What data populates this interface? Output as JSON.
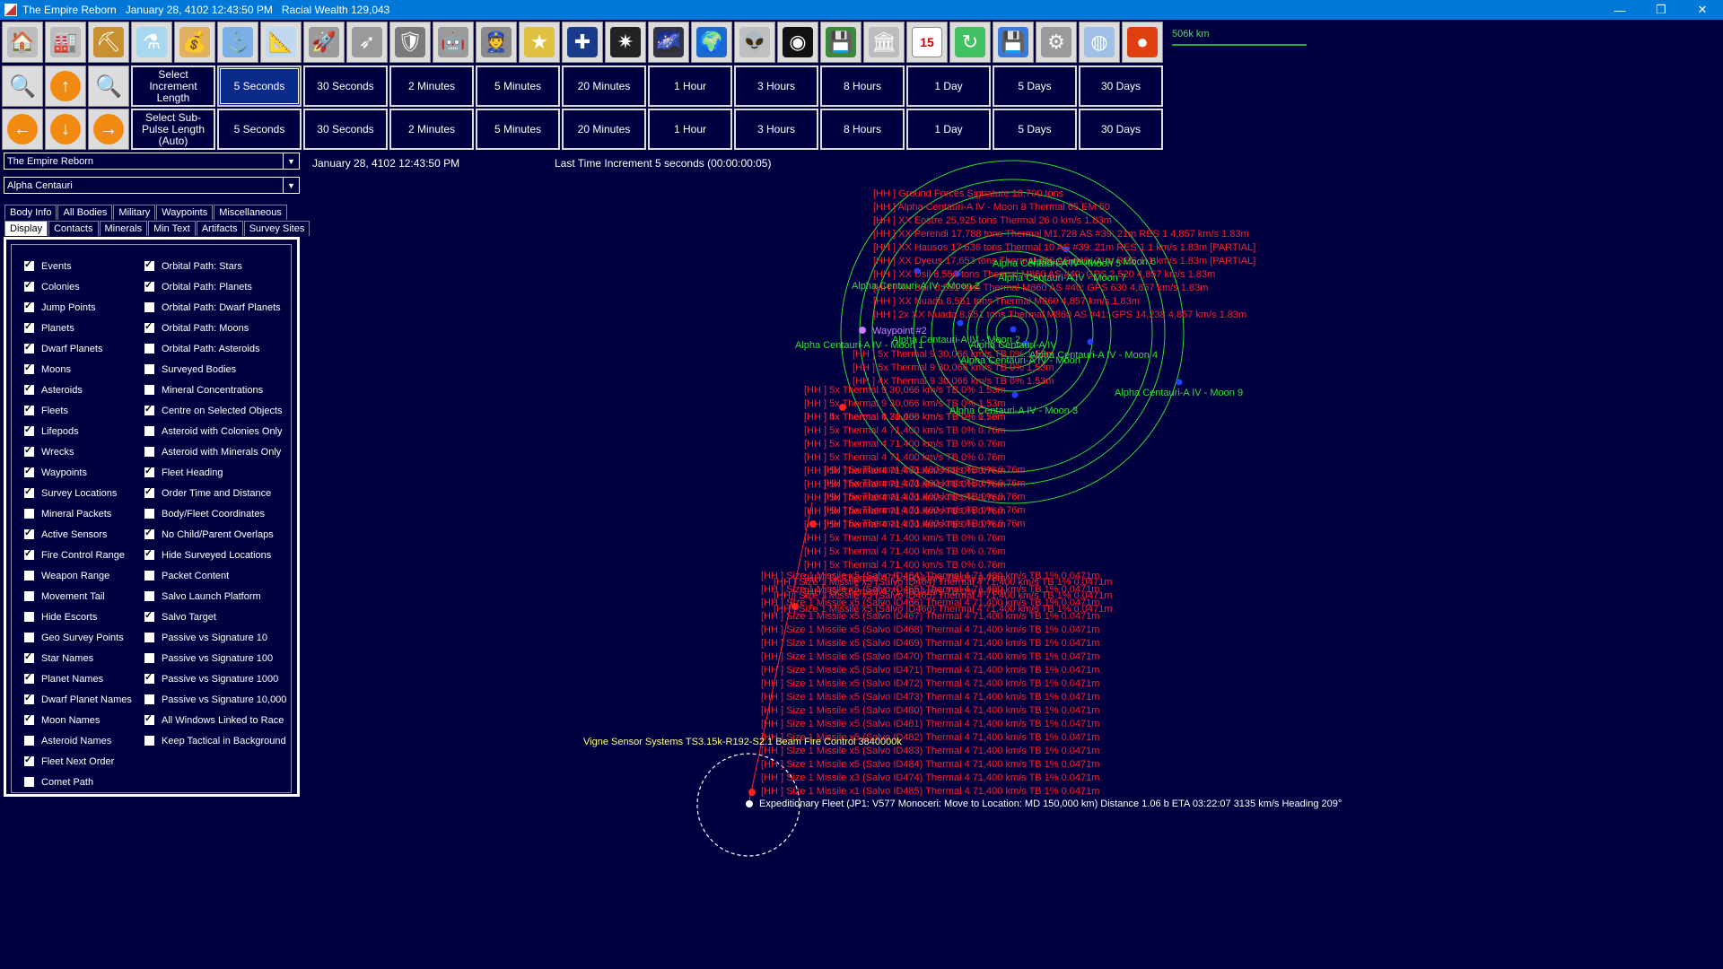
{
  "window": {
    "title": "The Empire Reborn   January 28, 4102 12:43:50 PM   Racial Wealth 129,043",
    "controls": [
      "—",
      "❐",
      "✕"
    ]
  },
  "toolbar_icons": [
    {
      "name": "colony-icon",
      "glyph": "🏠",
      "bg": "#bcbcbc"
    },
    {
      "name": "industry-icon",
      "glyph": "🏭",
      "bg": "#bcbcbc"
    },
    {
      "name": "mining-icon",
      "glyph": "⛏",
      "bg": "#c89030"
    },
    {
      "name": "research-icon",
      "glyph": "⚗",
      "bg": "#a8d8f0"
    },
    {
      "name": "wealth-icon",
      "glyph": "💰",
      "bg": "#e0b060"
    },
    {
      "name": "shipyard-icon",
      "glyph": "⚓",
      "bg": "#7ab0e8"
    },
    {
      "name": "design-icon",
      "glyph": "📐",
      "bg": "#c0d8f0"
    },
    {
      "name": "fleet-icon",
      "glyph": "🚀",
      "bg": "#9a9a9a"
    },
    {
      "name": "missile-icon",
      "glyph": "➶",
      "bg": "#9a9a9a"
    },
    {
      "name": "ground-forces-icon",
      "glyph": "🛡",
      "bg": "#7a7a7a"
    },
    {
      "name": "mech-icon",
      "glyph": "🤖",
      "bg": "#9a9a9a"
    },
    {
      "name": "commander-icon",
      "glyph": "👮",
      "bg": "#8a8a8a"
    },
    {
      "name": "medal-icon",
      "glyph": "★",
      "bg": "#e0c040"
    },
    {
      "name": "flag-icon",
      "glyph": "✚",
      "bg": "#1a3a8a"
    },
    {
      "name": "system-map-icon",
      "glyph": "✷",
      "bg": "#222"
    },
    {
      "name": "galaxy-map-icon",
      "glyph": "🌌",
      "bg": "#334"
    },
    {
      "name": "planet-icon",
      "glyph": "🌍",
      "bg": "#1a6ad0"
    },
    {
      "name": "alien-icon",
      "glyph": "👽",
      "bg": "#c0c0c0"
    },
    {
      "name": "intel-icon",
      "glyph": "◉",
      "bg": "#111"
    },
    {
      "name": "tech-icon",
      "glyph": "💾",
      "bg": "#3a8a3a"
    },
    {
      "name": "government-icon",
      "glyph": "🏛",
      "bg": "#bcbcbc"
    },
    {
      "name": "calendar-icon",
      "glyph": "15",
      "bg": "#ffffff"
    },
    {
      "name": "refresh-icon",
      "glyph": "↻",
      "bg": "#40c060"
    },
    {
      "name": "save-icon",
      "glyph": "💾",
      "bg": "#3a7ae0"
    },
    {
      "name": "settings-icon",
      "glyph": "⚙",
      "bg": "#9a9a9a"
    },
    {
      "name": "sphere-icon",
      "glyph": "◍",
      "bg": "#a0c0e8"
    },
    {
      "name": "red-sphere-icon",
      "glyph": "●",
      "bg": "#e04010"
    }
  ],
  "scale": {
    "label": "506k km"
  },
  "increment": {
    "label": "Select Increment Length",
    "selected": "5 Seconds",
    "options": [
      "5 Seconds",
      "30 Seconds",
      "2 Minutes",
      "5 Minutes",
      "20 Minutes",
      "1 Hour",
      "3 Hours",
      "8 Hours",
      "1 Day",
      "5 Days",
      "30 Days"
    ]
  },
  "subpulse": {
    "label": "Select Sub-Pulse Length (Auto)",
    "options": [
      "5 Seconds",
      "30 Seconds",
      "2 Minutes",
      "5 Minutes",
      "20 Minutes",
      "1 Hour",
      "3 Hours",
      "8 Hours",
      "1 Day",
      "5 Days",
      "30 Days"
    ]
  },
  "nav_buttons": {
    "row2": [
      "zoom-in-icon",
      "up-arrow-icon",
      "zoom-out-icon"
    ],
    "row3": [
      "left-arrow-icon",
      "down-arrow-icon",
      "right-arrow-icon"
    ]
  },
  "race_select": "The Empire Reborn",
  "system_select": "Alpha Centauri",
  "game_date": "January 28, 4102 12:43:50 PM",
  "last_increment": "Last Time Increment 5 seconds (00:00:00:05)",
  "tabs_row1": [
    "Body Info",
    "All Bodies",
    "Military",
    "Waypoints",
    "Miscellaneous"
  ],
  "tabs_row2": [
    "Display",
    "Contacts",
    "Minerals",
    "Min Text",
    "Artifacts",
    "Survey Sites"
  ],
  "active_tab": "Display",
  "options_col1": [
    {
      "label": "Events",
      "on": true
    },
    {
      "label": "Colonies",
      "on": true
    },
    {
      "label": "Jump Points",
      "on": true
    },
    {
      "label": "Planets",
      "on": true
    },
    {
      "label": "Dwarf Planets",
      "on": true
    },
    {
      "label": "Moons",
      "on": true
    },
    {
      "label": "Asteroids",
      "on": true
    },
    {
      "label": "Fleets",
      "on": true
    },
    {
      "label": "Lifepods",
      "on": true
    },
    {
      "label": "Wrecks",
      "on": true
    },
    {
      "label": "Waypoints",
      "on": true
    },
    {
      "label": "Survey Locations",
      "on": true
    },
    {
      "label": "Mineral Packets",
      "on": false
    },
    {
      "label": "Active Sensors",
      "on": true
    },
    {
      "label": "Fire Control Range",
      "on": true
    },
    {
      "label": "Weapon Range",
      "on": false
    },
    {
      "label": "Movement Tail",
      "on": false
    },
    {
      "label": "Hide Escorts",
      "on": false
    },
    {
      "label": "Geo Survey Points",
      "on": false
    },
    {
      "label": "Star Names",
      "on": true
    },
    {
      "label": "Planet Names",
      "on": true
    },
    {
      "label": "Dwarf Planet Names",
      "on": true
    },
    {
      "label": "Moon Names",
      "on": true
    },
    {
      "label": "Asteroid Names",
      "on": false
    },
    {
      "label": "Fleet Next Order",
      "on": true
    },
    {
      "label": "Comet Path",
      "on": false
    }
  ],
  "options_col2": [
    {
      "label": "Orbital Path: Stars",
      "on": true
    },
    {
      "label": "Orbital Path: Planets",
      "on": true
    },
    {
      "label": "Orbital Path: Dwarf Planets",
      "on": false
    },
    {
      "label": "Orbital Path: Moons",
      "on": true
    },
    {
      "label": "Orbital Path: Asteroids",
      "on": false
    },
    {
      "label": "Surveyed Bodies",
      "on": false
    },
    {
      "label": "Mineral Concentrations",
      "on": false
    },
    {
      "label": "Centre on Selected Objects",
      "on": true
    },
    {
      "label": "Asteroid with Colonies Only",
      "on": false
    },
    {
      "label": "Asteroid with Minerals Only",
      "on": false
    },
    {
      "label": "Fleet Heading",
      "on": true
    },
    {
      "label": "Order Time and Distance",
      "on": true
    },
    {
      "label": "Body/Fleet Coordinates",
      "on": false
    },
    {
      "label": "No Child/Parent Overlaps",
      "on": true
    },
    {
      "label": "Hide Surveyed Locations",
      "on": true
    },
    {
      "label": "Packet Content",
      "on": false
    },
    {
      "label": "Salvo Launch Platform",
      "on": false
    },
    {
      "label": "Salvo Target",
      "on": true
    },
    {
      "label": "Passive vs Signature 10",
      "on": false
    },
    {
      "label": "Passive vs Signature 100",
      "on": false
    },
    {
      "label": "Passive vs Signature 1000",
      "on": true
    },
    {
      "label": "Passive vs Signature 10,000",
      "on": false
    },
    {
      "label": "All Windows Linked to Race",
      "on": true
    },
    {
      "label": "Keep Tactical in Background",
      "on": false
    }
  ],
  "map": {
    "colors": {
      "contact": "#ff2020",
      "body": "#30e030",
      "waypoint": "#d080ff",
      "fleet": "#ffffff",
      "sensor_label": "#ffff80"
    },
    "contacts_top": [
      "[HH ]  Ground Forces Signature 18,700 tons",
      "[HH ]  Alpha Centauri-A IV - Moon 8   Thermal 65   EM 50",
      "[HH ]  XX Eostre  25,925 tons   Thermal 26   0 km/s  1.83m",
      "[HH ]  XX Perendi  17,788 tons   Thermal M1,728   AS #39: 21m RES 1   4,857 km/s  1.83m",
      "[HH ]  XX Hausos  17,636 tons   Thermal 10   AS #39: 21m RES 1   1 km/s  1.83m   [PARTIAL]",
      "[HH ]  XX Dyeus  17,653 tons   Thermal 130   AS #40: 21m RES 1   1 km/s  1.83m   [PARTIAL]",
      "[HH ]  XX Usil  8,550 tons   Thermal M860   AS #40: GPS 2,520   4,857 km/s  1.83m",
      "[HH ]  XX Suri  8,551 tons   Thermal M860   AS #40: GPS 630   4,857 km/s  1.83m",
      "[HH ]  XX Nuada  8,551 tons   Thermal M860   4,857 km/s  1.83m",
      "[HH ]  2x  XX Nuada  8,851 tons   Thermal M860   AS #41: GPS 14,238   4,857 km/s  1.83m"
    ],
    "thermal9": [
      "[HH ]  5x  Thermal 9   30,066 km/s   TB 0%   1.53m",
      "[HH ]  5x  Thermal 9   30,066 km/s   TB 0%   1.53m",
      "[HH ]  4x  Thermal 9   30,066 km/s   TB 0%   1.53m"
    ],
    "thermal4": [
      "[HH ]  5x  Thermal 4   71,400 km/s   TB 0%   0.76m",
      "[HH ]  5x  Thermal 4   71,400 km/s   TB 0%   0.76m",
      "[HH ]  5x  Thermal 4   71,400 km/s   TB 0%   0.76m",
      "[HH ]  5x  Thermal 4   71,400 km/s   TB 0%   0.76m",
      "[HH ]  5x  Thermal 4   71,400 km/s   TB 0%   0.76m",
      "[HH ]  5x  Thermal 4   71,400 km/s   TB 0%   0.76m",
      "[HH ]  5x  Thermal 4   71,400 km/s   TB 0%   0.76m",
      "[HH ]  5x  Thermal 4   71,400 km/s   TB 0%   0.76m",
      "[HH ]  5x  Thermal 4   71,400 km/s   TB 0%   0.76m",
      "[HH ]  5x  Thermal 4   71,400 km/s   TB 0%   0.76m",
      "[HH ]  5x  Thermal 4   71,400 km/s   TB 0%   0.76m",
      "[HH ]  5x  Thermal 4   71,400 km/s   TB 0%   0.76m",
      "[HH ]  5x  Thermal 4   71,400 km/s   TB 0%   0.76m",
      "[HH ]  5x  Thermal 4   71,400 km/s   TB 0%   0.76m"
    ],
    "thermal4_overlap": [
      "[HH ]  5x  Thermal 4   71,400 km/s   TB 0%   0.76m",
      "[HH ]  5x  Thermal 4   71,400 km/s   TB 0%   0.76m",
      "[HH ]  5x  Thermal 4   71,400 km/s   TB 0%   0.76m",
      "[HH ]  5x  Thermal 4   71,400 km/s   TB 0%   0.76m",
      "[HH ]  5x  Thermal 4   71,400 km/s   TB 0%   0.76m"
    ],
    "missiles": [
      "[HH ]  Size 1 Missile x5   (Salvo ID464)   Thermal 4   71,400 km/s   TB 1%   0.0471m",
      "[HH ]  Size 1 Missile x5   (Salvo ID465)   Thermal 4   71,400 km/s   TB 1%   0.0471m",
      "[HH ]  Size 1 Missile x5   (Salvo ID466)   Thermal 4   71,400 km/s   TB 1%   0.0471m",
      "[HH ]  Size 1 Missile x5   (Salvo ID467)   Thermal 4   71,400 km/s   TB 1%   0.0471m",
      "[HH ]  Size 1 Missile x5   (Salvo ID468)   Thermal 4   71,400 km/s   TB 1%   0.0471m",
      "[HH ]  Size 1 Missile x5   (Salvo ID469)   Thermal 4   71,400 km/s   TB 1%   0.0471m",
      "[HH ]  Size 1 Missile x5   (Salvo ID470)   Thermal 4   71,400 km/s   TB 1%   0.0471m",
      "[HH ]  Size 1 Missile x5   (Salvo ID471)   Thermal 4   71,400 km/s   TB 1%   0.0471m",
      "[HH ]  Size 1 Missile x5   (Salvo ID472)   Thermal 4   71,400 km/s   TB 1%   0.0471m",
      "[HH ]  Size 1 Missile x5   (Salvo ID473)   Thermal 4   71,400 km/s   TB 1%   0.0471m",
      "[HH ]  Size 1 Missile x5   (Salvo ID480)   Thermal 4   71,400 km/s   TB 1%   0.0471m",
      "[HH ]  Size 1 Missile x5   (Salvo ID481)   Thermal 4   71,400 km/s   TB 1%   0.0471m",
      "[HH ]  Size 1 Missile x5   (Salvo ID482)   Thermal 4   71,400 km/s   TB 1%   0.0471m",
      "[HH ]  Size 1 Missile x5   (Salvo ID483)   Thermal 4   71,400 km/s   TB 1%   0.0471m",
      "[HH ]  Size 1 Missile x5   (Salvo ID484)   Thermal 4   71,400 km/s   TB 1%   0.0471m",
      "[HH ]  Size 1 Missile x3   (Salvo ID474)   Thermal 4   71,400 km/s   TB 1%   0.0471m",
      "[HH ]  Size 1 Missile x1   (Salvo ID485)   Thermal 4   71,400 km/s   TB 1%   0.0471m"
    ],
    "bodies": [
      "Alpha Centauri-A IV - Moon 2",
      "Alpha Centauri-A IV - Moon 5",
      "Alpha Centauri-A IV - Moon 7",
      "Alpha Centauri-A IV - Moon 6",
      "Alpha Centauri-A IV - Moon 2",
      "Alpha Centauri-A IV",
      "Alpha Centauri-A IV - Moon 1",
      "Alpha Centauri-A IV - Moon 4",
      "Alpha Centauri-A IV - Moon 9",
      "Alpha Centauri-A IV - Moon 3",
      "Alpha Centauri-A IV - Moon"
    ],
    "waypoint": "Waypoint #2",
    "sensor": "Vigne Sensor Systems TS3.15k-R192-S2.1 Beam Fire Control  3840000k",
    "fleet": "Expeditionary Fleet  (JP1: V577 Monoceri: Move to Location: MD 150,000 km)   Distance 1.06 b   ETA 03:22:07   3135 km/s   Heading 209°"
  }
}
